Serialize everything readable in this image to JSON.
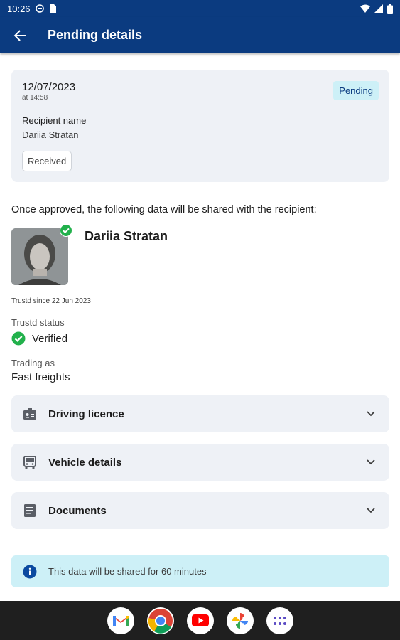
{
  "status_bar": {
    "time": "10:26",
    "icons": [
      "sync-icon",
      "sim-card-icon",
      "wifi-icon",
      "signal-icon",
      "battery-icon"
    ]
  },
  "app_bar": {
    "title": "Pending details",
    "back_icon": "arrow-left-icon"
  },
  "summary": {
    "date": "12/07/2023",
    "time": "at 14:58",
    "status": "Pending",
    "recipient_label": "Recipient name",
    "recipient_name": "Dariia Stratan",
    "chip": "Received"
  },
  "share_intro": "Once approved, the following data will be shared with the recipient:",
  "profile": {
    "name": "Dariia Stratan",
    "since": "Trustd since 22 Jun 2023",
    "status_label": "Trustd status",
    "status_value": "Verified",
    "trading_label": "Trading as",
    "trading_value": "Fast freights"
  },
  "sections": [
    {
      "label": "Driving licence",
      "icon": "id-card-icon"
    },
    {
      "label": "Vehicle details",
      "icon": "bus-icon"
    },
    {
      "label": "Documents",
      "icon": "document-icon"
    }
  ],
  "info_banner": "This data will be shared for 60 minutes",
  "dock_apps": [
    "Gmail",
    "Chrome",
    "YouTube",
    "Photos",
    "App drawer"
  ],
  "colors": {
    "primary": "#0b3b80",
    "card": "#eef1f6",
    "accent_cyan": "#cdf0f7",
    "success": "#22b14c"
  }
}
